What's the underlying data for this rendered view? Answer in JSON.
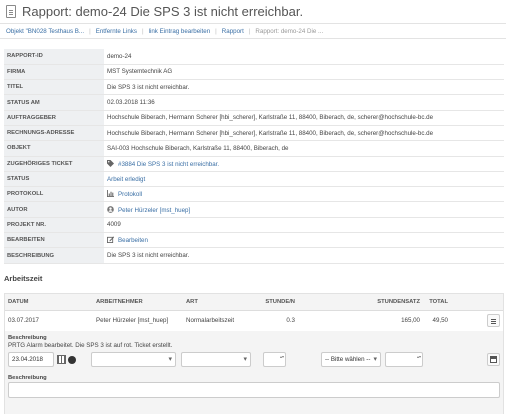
{
  "page": {
    "title": "Rapport: demo-24 Die SPS 3 ist nicht erreichbar."
  },
  "breadcrumb": [
    {
      "label": "Objekt \"BN028 Testhaus B..."
    },
    {
      "label": "Entfernte Links"
    },
    {
      "label": "link Eintrag bearbeiten"
    },
    {
      "label": "Rapport"
    }
  ],
  "breadcrumb_current": "Rapport: demo-24 Die ...",
  "details": {
    "rapport_id": {
      "label": "RAPPORT-ID",
      "value": "demo-24"
    },
    "firma": {
      "label": "FIRMA",
      "value": "MST Systemtechnik AG"
    },
    "titel": {
      "label": "TITEL",
      "value": "Die SPS 3 ist nicht erreichbar."
    },
    "status_am": {
      "label": "STATUS AM",
      "value": "02.03.2018 11:36"
    },
    "auftraggeber": {
      "label": "AUFTRAGGEBER",
      "value": "Hochschule Biberach, Hermann Scherer [hbi_scherer], Karlstraße 11, 88400, Biberach, de, scherer@hochschule-bc.de"
    },
    "rechnungsadresse": {
      "label": "RECHNUNGS-ADRESSE",
      "value": "Hochschule Biberach, Hermann Scherer [hbi_scherer], Karlstraße 11, 88400, Biberach, de, scherer@hochschule-bc.de"
    },
    "objekt": {
      "label": "OBJEKT",
      "value": "SAI-003 Hochschule Biberach, Karlstraße 11, 88400, Biberach, de"
    },
    "ticket": {
      "label": "ZUGEHÖRIGES TICKET",
      "value": "#3884 Die SPS 3 ist nicht erreichbar.",
      "icon": "tag-icon"
    },
    "status": {
      "label": "STATUS",
      "value": "Arbeit erledigt"
    },
    "protokoll": {
      "label": "PROTOKOLL",
      "value": "Protokoll",
      "icon": "chart-icon"
    },
    "autor": {
      "label": "AUTOR",
      "value": "Peter Hürzeler [mst_huep]",
      "icon": "user-icon"
    },
    "projekt_nr": {
      "label": "PROJEKT NR.",
      "value": "4009"
    },
    "bearbeiten": {
      "label": "BEARBEITEN",
      "value": "Bearbeiten",
      "icon": "edit-icon"
    },
    "beschreibung": {
      "label": "BESCHREIBUNG",
      "value": "Die SPS 3 ist nicht erreichbar."
    }
  },
  "arbeitszeit": {
    "title": "Arbeitszeit",
    "columns": {
      "datum": "DATUM",
      "arbeitnehmer": "ARBEITNEHMER",
      "art": "ART",
      "stunden": "STUNDE/N",
      "stundensatz": "STUNDENSATZ",
      "total": "TOTAL"
    },
    "row": {
      "datum": "03.07.2017",
      "arbeitnehmer": "Peter Hürzeler [mst_huep]",
      "art": "Normalarbeitszeit",
      "stunden": "0.3",
      "stundensatz": "165,00",
      "total": "49,50"
    },
    "row_desc_label": "Beschreibung",
    "row_desc_text": "PRTG Alarm bearbeitet. Die SPS 3 ist auf rot. Ticket erstellt.",
    "form": {
      "date_value": "23.04.2018",
      "select_placeholder": "-- Bitte wählen --",
      "desc_label": "Beschreibung"
    }
  },
  "colors": {
    "label_bg": "#eef0f2",
    "link": "#3a6fa5",
    "panel_bg": "#f4f4f4"
  }
}
